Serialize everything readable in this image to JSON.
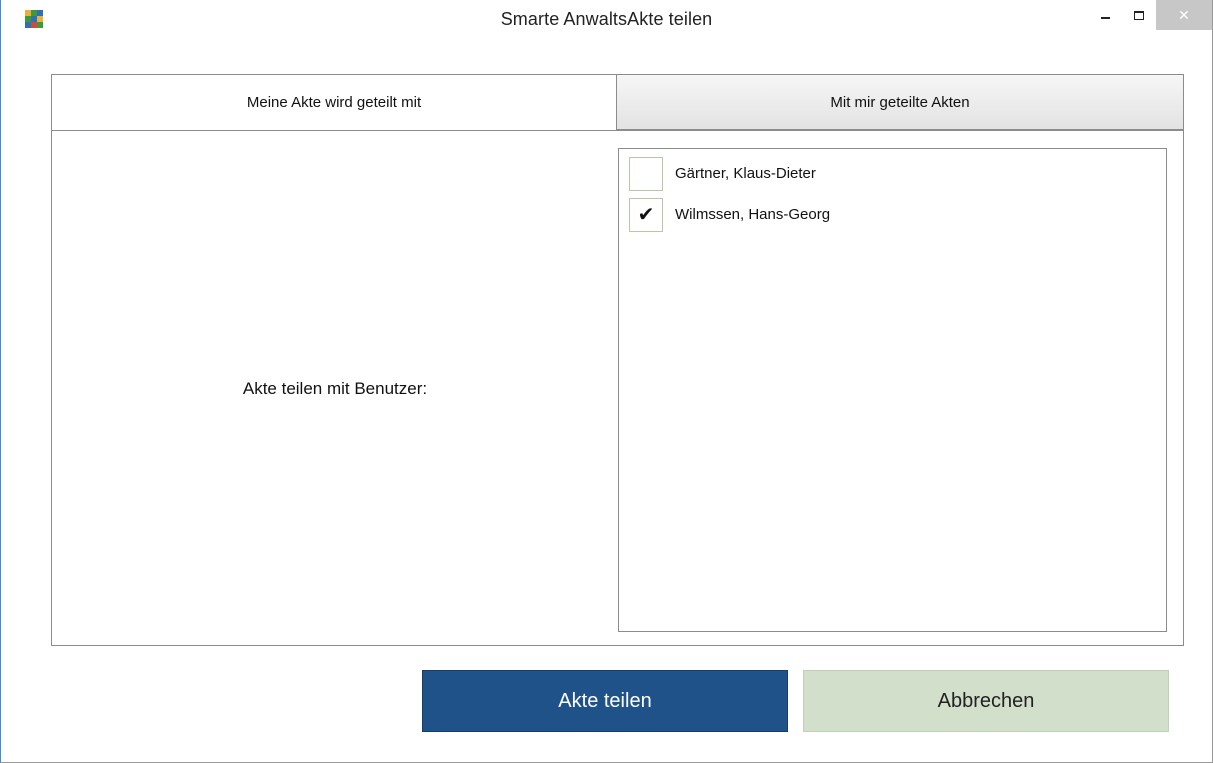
{
  "window": {
    "title": "Smarte AnwaltsAkte teilen",
    "controls": {
      "minimize": "–",
      "maximize": "□",
      "close": "✕"
    }
  },
  "tabs": [
    {
      "label": "Meine Akte wird geteilt mit",
      "active": true
    },
    {
      "label": "Mit mir geteilte Akten",
      "active": false
    }
  ],
  "share_panel": {
    "label": "Akte teilen mit Benutzer:",
    "users": [
      {
        "name": "Gärtner, Klaus-Dieter",
        "checked": false,
        "check_glyph": ""
      },
      {
        "name": "Wilmssen, Hans-Georg",
        "checked": true,
        "check_glyph": "✔"
      }
    ]
  },
  "buttons": {
    "share": "Akte teilen",
    "cancel": "Abbrechen"
  },
  "colors": {
    "primary_button": "#1f5288",
    "secondary_button": "#d1dfcb",
    "window_border_accent": "#3a8fd6"
  },
  "icons": {
    "app": "app-logo-icon",
    "checkmark": "checkmark-icon"
  }
}
